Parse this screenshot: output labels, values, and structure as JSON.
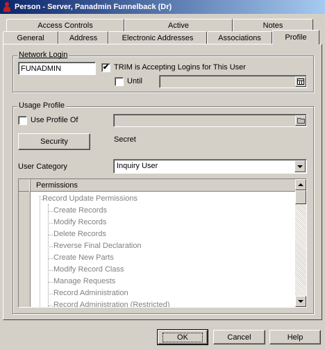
{
  "window": {
    "title": "Person - Server, Panadmin Funnelback (Dr)"
  },
  "tabs_back": [
    "Access Controls",
    "Active",
    "Notes"
  ],
  "tabs_front": [
    "General",
    "Address",
    "Electronic Addresses",
    "Associations",
    "Profile"
  ],
  "active_tab": "Profile",
  "network_login": {
    "group_label": "Network Login",
    "username_value": "FUNADMIN",
    "trim_accepting_label": "TRIM is Accepting Logins for This User",
    "trim_accepting_checked": true,
    "trim_accepting_check_glyph": "✔",
    "until_label": "Until",
    "until_checked": false,
    "until_value": ""
  },
  "usage_profile": {
    "group_label": "Usage Profile",
    "use_profile_of_label": "Use Profile Of",
    "use_profile_of_checked": false,
    "use_profile_of_value": "",
    "security_button": "Security",
    "security_level": "Secret",
    "user_category_label": "User Category",
    "user_category_value": "Inquiry User"
  },
  "permissions": {
    "header": "Permissions",
    "group": "Record Update Permissions",
    "items": [
      "Create Records",
      "Modify Records",
      "Delete Records",
      "Reverse Final Declaration",
      "Create New Parts",
      "Modify Record Class",
      "Manage Requests",
      "Record Administration",
      "Record Administration (Restricted)"
    ]
  },
  "buttons": {
    "ok": "OK",
    "cancel": "Cancel",
    "help": "Help"
  },
  "colors": {
    "titlebar_start": "#0a246a",
    "titlebar_end": "#a6caf0",
    "face": "#d4d0c8",
    "disabled_text": "#808080"
  }
}
